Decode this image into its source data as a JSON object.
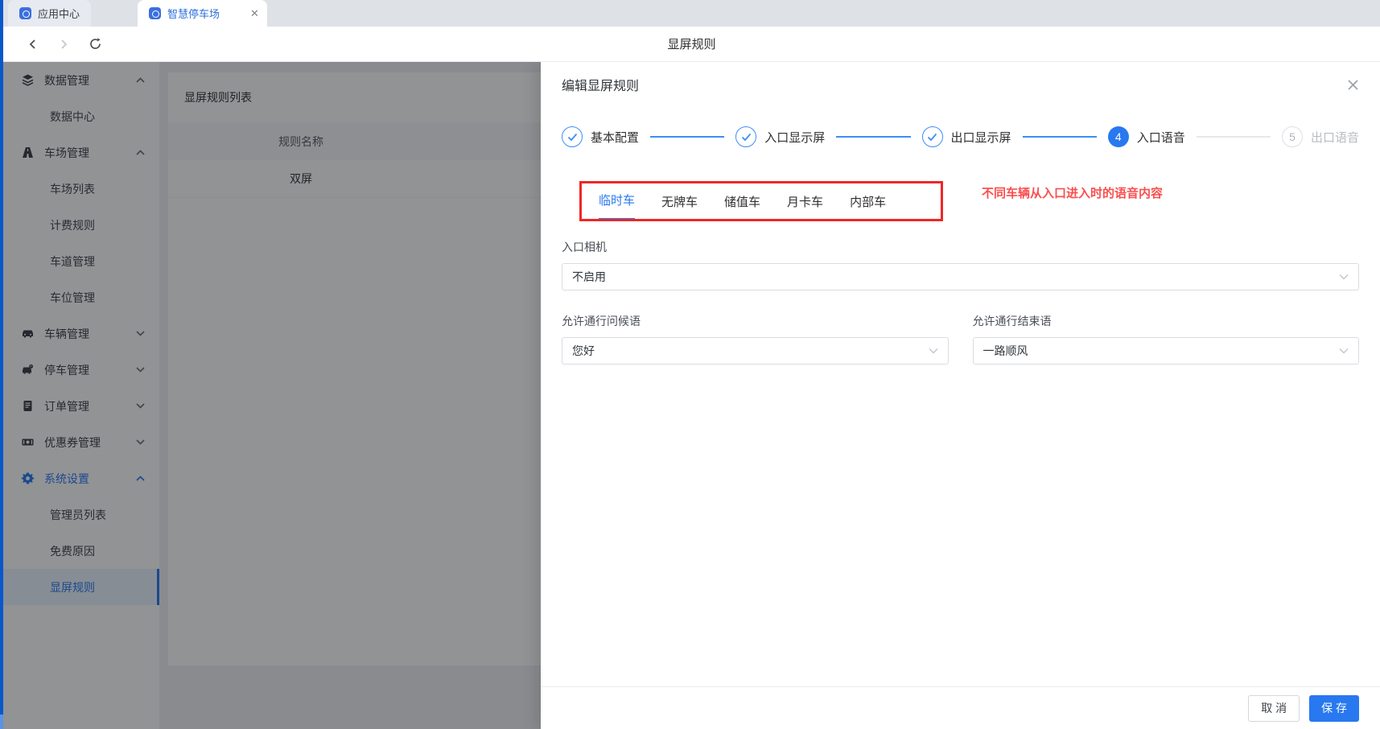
{
  "colors": {
    "accent_blue": "#2878f0",
    "step_done_blue": "#3e8ef7",
    "annotation_red": "#f02626",
    "annotation_text_red": "#fa4f4f",
    "mask": "rgba(13,16,20,0.45)",
    "edge_strip_blue": "#0a57cc"
  },
  "icons": {
    "app_center": "blue rounded-square app glyph",
    "smart_parking": "blue rounded-square app glyph",
    "back": "left chevron",
    "forward": "right chevron",
    "refresh": "circular arrow",
    "close": "x mark",
    "check": "check mark",
    "chevron_up": "up caret",
    "chevron_down": "down caret"
  },
  "browser": {
    "tabs": [
      {
        "label": "应用中心",
        "active": false
      },
      {
        "label": "智慧停车场",
        "active": true
      }
    ],
    "nav_title": "显屏规则"
  },
  "sidebar": {
    "groups": [
      {
        "label": "数据管理",
        "icon": "database-icon",
        "expanded": true,
        "children": [
          "数据中心"
        ]
      },
      {
        "label": "车场管理",
        "icon": "parking-lot-icon",
        "expanded": true,
        "children": [
          "车场列表",
          "计费规则",
          "车道管理",
          "车位管理"
        ]
      },
      {
        "label": "车辆管理",
        "icon": "car-icon",
        "expanded": false,
        "children": []
      },
      {
        "label": "停车管理",
        "icon": "parking-icon",
        "expanded": false,
        "children": []
      },
      {
        "label": "订单管理",
        "icon": "order-icon",
        "expanded": false,
        "children": []
      },
      {
        "label": "优惠券管理",
        "icon": "coupon-icon",
        "expanded": false,
        "children": []
      },
      {
        "label": "系统设置",
        "icon": "gear-icon",
        "expanded": true,
        "active_group": true,
        "children": [
          "管理员列表",
          "免费原因",
          "显屏规则"
        ],
        "active_child": "显屏规则"
      }
    ]
  },
  "list_panel": {
    "title": "显屏规则列表",
    "columns": [
      "规则名称"
    ],
    "rows": [
      [
        "双屏"
      ]
    ]
  },
  "drawer": {
    "title": "编辑显屏规则",
    "steps": [
      {
        "label": "基本配置",
        "state": "done"
      },
      {
        "label": "入口显示屏",
        "state": "done"
      },
      {
        "label": "出口显示屏",
        "state": "done"
      },
      {
        "label": "入口语音",
        "state": "current",
        "number": "4"
      },
      {
        "label": "出口语音",
        "state": "pending",
        "number": "5"
      }
    ],
    "vehicle_tabs": [
      {
        "label": "临时车",
        "active": true
      },
      {
        "label": "无牌车",
        "active": false
      },
      {
        "label": "储值车",
        "active": false
      },
      {
        "label": "月卡车",
        "active": false
      },
      {
        "label": "内部车",
        "active": false
      }
    ],
    "annotation": "不同车辆从入口进入时的语音内容",
    "form": {
      "camera_label": "入口相机",
      "camera_value": "不启用",
      "greeting_label": "允许通行问候语",
      "greeting_value": "您好",
      "ending_label": "允许通行结束语",
      "ending_value": "一路顺风"
    },
    "footer": {
      "cancel": "取 消",
      "save": "保 存"
    }
  }
}
